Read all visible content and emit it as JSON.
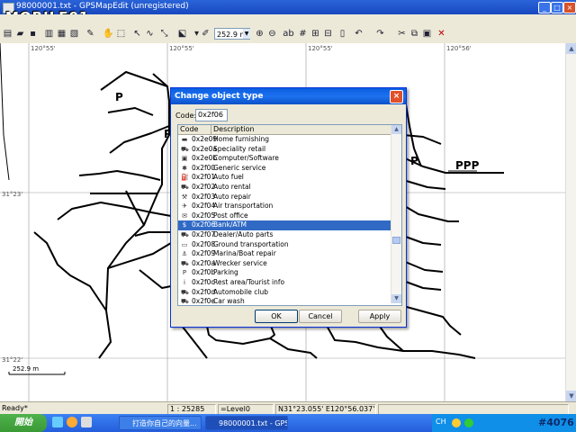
{
  "window": {
    "title": "98000001.txt - GPSMapEdit (unregistered)",
    "logo_text": "MOBILE01"
  },
  "toolbar": {
    "zoom_value": "252.9 m"
  },
  "map": {
    "coords": {
      "top_1": "120°55'",
      "top_2": "120°55'",
      "top_3": "120°55'",
      "top_4": "120°56'",
      "left_1": "31°23'",
      "left_2": "31°22'"
    },
    "scale_label": "252.9 m",
    "poi_labels": [
      "PPP"
    ]
  },
  "dialog": {
    "title": "Change object type",
    "code_label": "Code:",
    "code_value": "0x2f06",
    "col_code": "Code",
    "col_description": "Description",
    "rows": [
      {
        "code": "0x2e09",
        "desc": "Home furnishing",
        "icon": "sofa-icon",
        "glyph": "▬"
      },
      {
        "code": "0x2e0a",
        "desc": "Speciality retail",
        "icon": "cart-icon",
        "glyph": "⛟"
      },
      {
        "code": "0x2e0b",
        "desc": "Computer/Software",
        "icon": "computer-icon",
        "glyph": "▣"
      },
      {
        "code": "0x2f00",
        "desc": "Generic service",
        "icon": "service-icon",
        "glyph": "✱"
      },
      {
        "code": "0x2f01",
        "desc": "Auto fuel",
        "icon": "fuel-icon",
        "glyph": "⛽"
      },
      {
        "code": "0x2f02",
        "desc": "Auto rental",
        "icon": "car-icon",
        "glyph": "⛟"
      },
      {
        "code": "0x2f03",
        "desc": "Auto repair",
        "icon": "wrench-icon",
        "glyph": "⚒"
      },
      {
        "code": "0x2f04",
        "desc": "Air transportation",
        "icon": "plane-icon",
        "glyph": "✈"
      },
      {
        "code": "0x2f05",
        "desc": "Post office",
        "icon": "mail-icon",
        "glyph": "✉"
      },
      {
        "code": "0x2f06",
        "desc": "Bank/ATM",
        "icon": "bank-icon",
        "glyph": "$",
        "selected": true
      },
      {
        "code": "0x2f07",
        "desc": "Dealer/Auto parts",
        "icon": "dealer-icon",
        "glyph": "⛟"
      },
      {
        "code": "0x2f08",
        "desc": "Ground transportation",
        "icon": "bus-icon",
        "glyph": "▭"
      },
      {
        "code": "0x2f09",
        "desc": "Marina/Boat repair",
        "icon": "boat-icon",
        "glyph": "⚓"
      },
      {
        "code": "0x2f0a",
        "desc": "Wrecker service",
        "icon": "tow-icon",
        "glyph": "⛟"
      },
      {
        "code": "0x2f0b",
        "desc": "Parking",
        "icon": "parking-icon",
        "glyph": "P"
      },
      {
        "code": "0x2f0c",
        "desc": "Rest area/Tourist info",
        "icon": "info-icon",
        "glyph": "i"
      },
      {
        "code": "0x2f0d",
        "desc": "Automobile club",
        "icon": "club-icon",
        "glyph": "⛟"
      },
      {
        "code": "0x2f0e",
        "desc": "Car wash",
        "icon": "carwash-icon",
        "glyph": "⛟"
      }
    ],
    "ok_label": "OK",
    "cancel_label": "Cancel",
    "apply_label": "Apply"
  },
  "status": {
    "ready": "Ready*",
    "scale": "1 : 25285",
    "level": "=Level0",
    "position": "N31°23.055' E120°56.037'"
  },
  "taskbar": {
    "start": "開始",
    "task_1": "打造你自己的向量...",
    "task_2": "98000001.txt - GPSM...",
    "lang": "CH",
    "watermark": "#4076"
  },
  "colors": {
    "titlebar": "#1848c0",
    "selection": "#316ac5",
    "taskbar": "#245edb",
    "road": "#000000"
  }
}
